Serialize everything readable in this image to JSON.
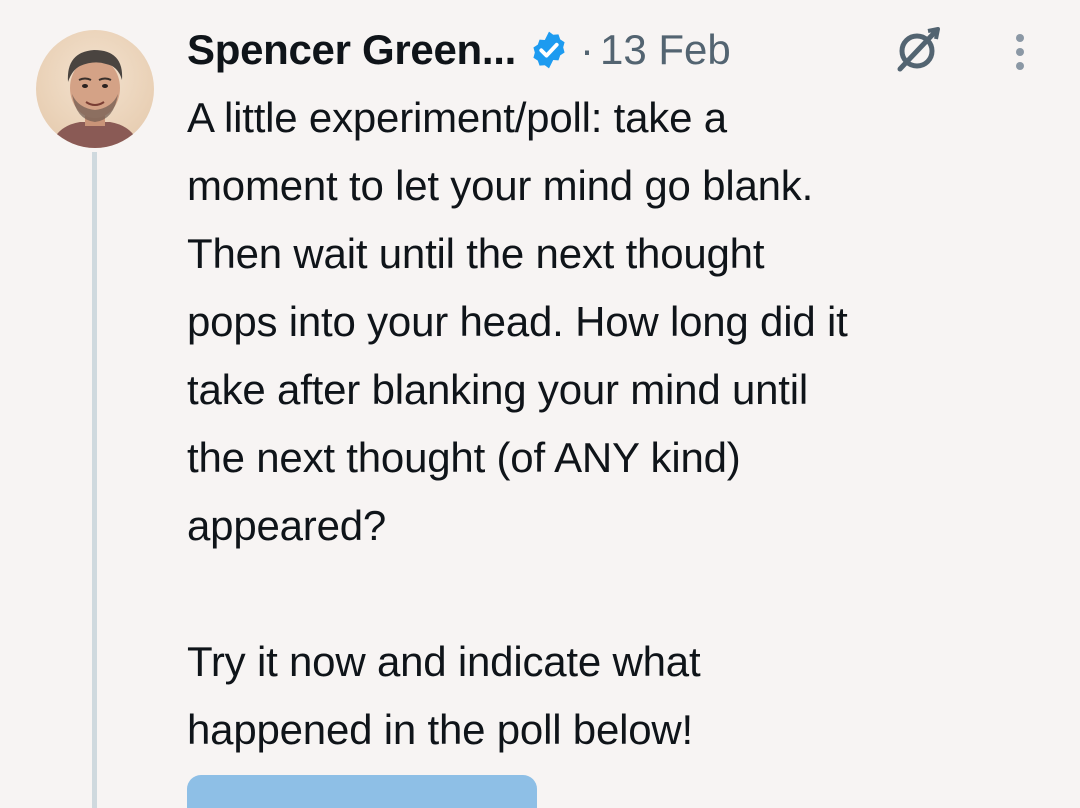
{
  "tweet": {
    "author": {
      "display_name": "Spencer Green...",
      "verified": true,
      "avatar_icon": "user-avatar-photo"
    },
    "separator": "·",
    "date": "13 Feb",
    "text": "A little experiment/poll: take a\nmoment to let your mind go blank.\nThen wait until the next thought\npops into your head. How long did it\ntake after blanking your mind until\nthe next thought (of ANY kind)\nappeared?\n\nTry it now and indicate what\nhappened in the poll below!",
    "actions": {
      "grok_icon": "grok-icon",
      "more_icon": "more-vertical-icon"
    }
  },
  "colors": {
    "background": "#f7f4f3",
    "text": "#0f1419",
    "secondary_text": "#536471",
    "verified_badge": "#1d9bf0",
    "thread_line": "#cfd9de",
    "poll_bar": "#8ebfe6"
  }
}
